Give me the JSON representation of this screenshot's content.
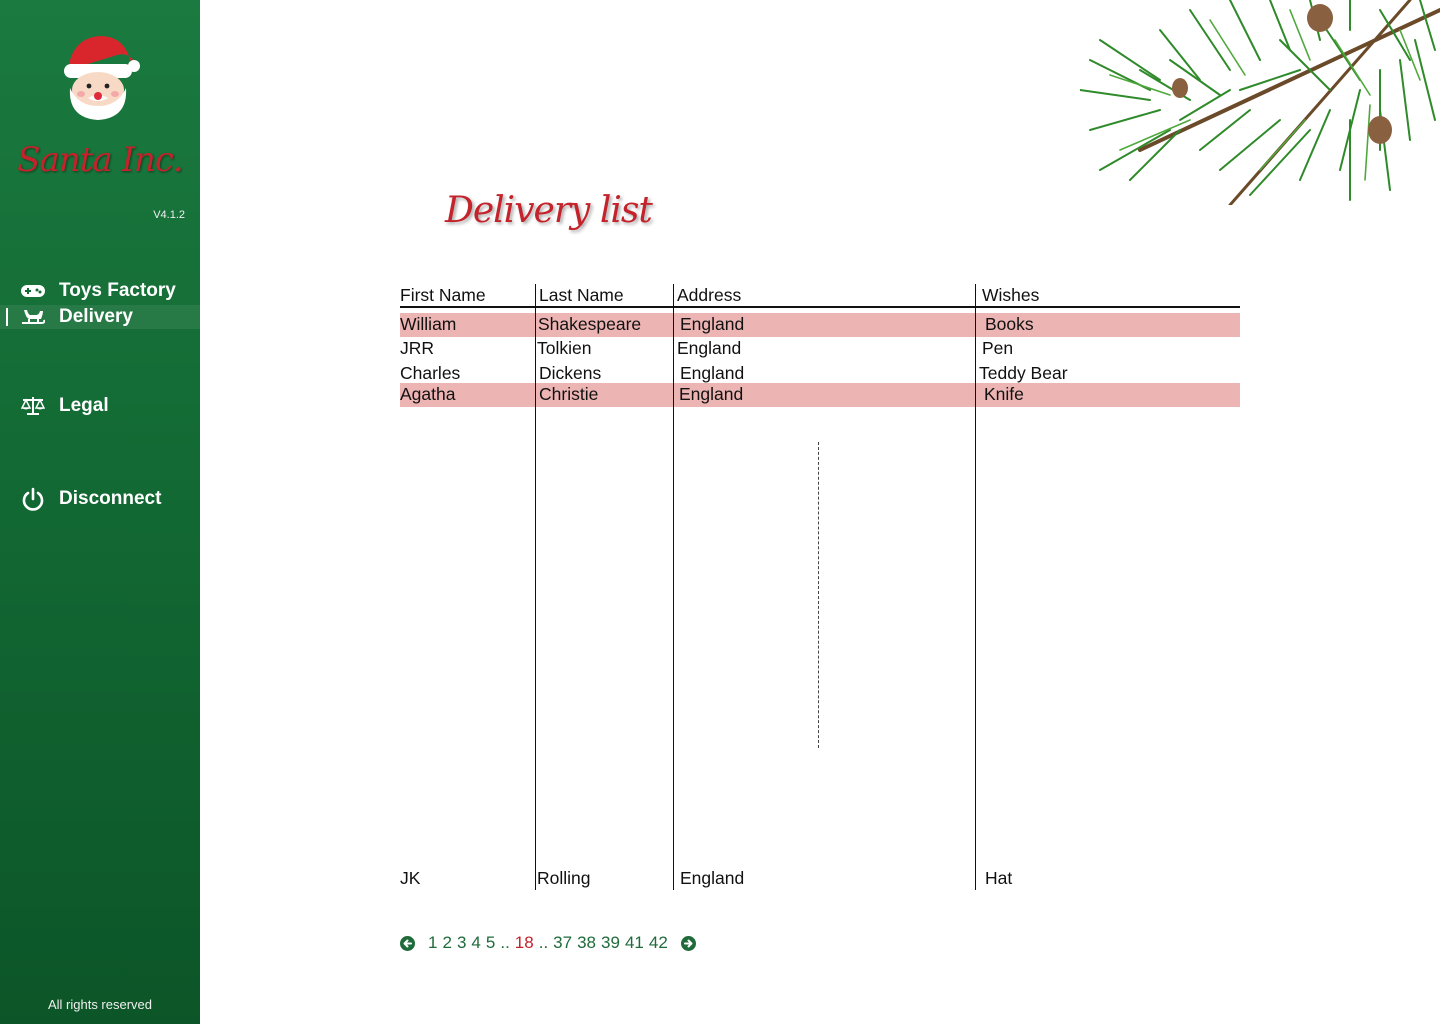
{
  "sidebar": {
    "brand": "Santa Inc.",
    "version": "V4.1.2",
    "nav": [
      {
        "label": "Toys Factory",
        "icon": "gamepad-icon"
      },
      {
        "label": "Delivery",
        "icon": "sleigh-icon",
        "active": true
      },
      {
        "label": "Legal",
        "icon": "scale-icon"
      },
      {
        "label": "Disconnect",
        "icon": "power-icon"
      }
    ],
    "footer": "All rights reserved"
  },
  "main": {
    "title": "Delivery list",
    "table": {
      "columns": [
        "First Name",
        "Last Name",
        "Address",
        "Wishes"
      ],
      "rows": [
        {
          "first": "William",
          "last": "Shakespeare",
          "address": "England",
          "wish": "Books",
          "highlight": true
        },
        {
          "first": "JRR",
          "last": "Tolkien",
          "address": "England",
          "wish": "Pen",
          "highlight": false
        },
        {
          "first": "Charles",
          "last": "Dickens",
          "address": "England",
          "wish": "Teddy Bear",
          "highlight": false
        },
        {
          "first": "Agatha",
          "last": "Christie",
          "address": "England",
          "wish": "Knife",
          "highlight": true
        },
        {
          "first": "JK",
          "last": "Rolling",
          "address": "England",
          "wish": "Hat",
          "highlight": false
        }
      ]
    },
    "pagination": {
      "pages": [
        "1",
        "2",
        "3",
        "4",
        "5",
        "..",
        "18",
        "..",
        "37",
        "38",
        "39",
        "41",
        "42"
      ],
      "current": "18"
    }
  },
  "colors": {
    "sidebar_green": "#1a7a3f",
    "accent_red": "#c4232b",
    "row_highlight": "#edb4b4",
    "pager_green": "#1f6b3a"
  }
}
